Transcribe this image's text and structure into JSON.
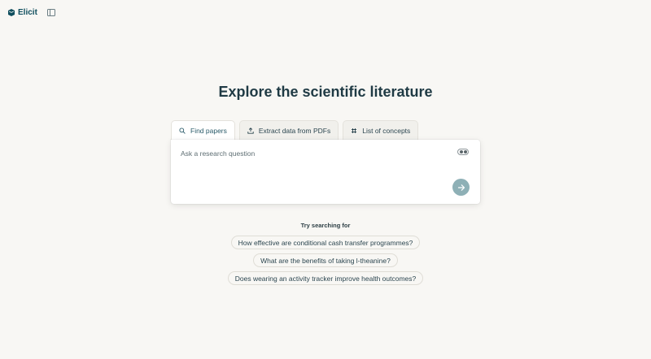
{
  "app": {
    "brand_name": "Elicit"
  },
  "main": {
    "headline": "Explore the scientific literature",
    "tabs": [
      {
        "label": "Find papers",
        "icon": "search-icon",
        "active": true
      },
      {
        "label": "Extract data from PDFs",
        "icon": "upload-icon",
        "active": false
      },
      {
        "label": "List of concepts",
        "icon": "concepts-icon",
        "active": false
      }
    ],
    "search": {
      "placeholder": "Ask a research question",
      "value": ""
    },
    "suggestions_heading": "Try searching for",
    "suggestions": [
      "How effective are conditional cash transfer programmes?",
      "What are the benefits of taking l-theanine?",
      "Does wearing an activity tracker improve health outcomes?"
    ]
  },
  "colors": {
    "background": "#f8f7f4",
    "brand": "#0f4e5e",
    "submit_button": "#8eb0b6",
    "headline": "#1f3a44"
  }
}
